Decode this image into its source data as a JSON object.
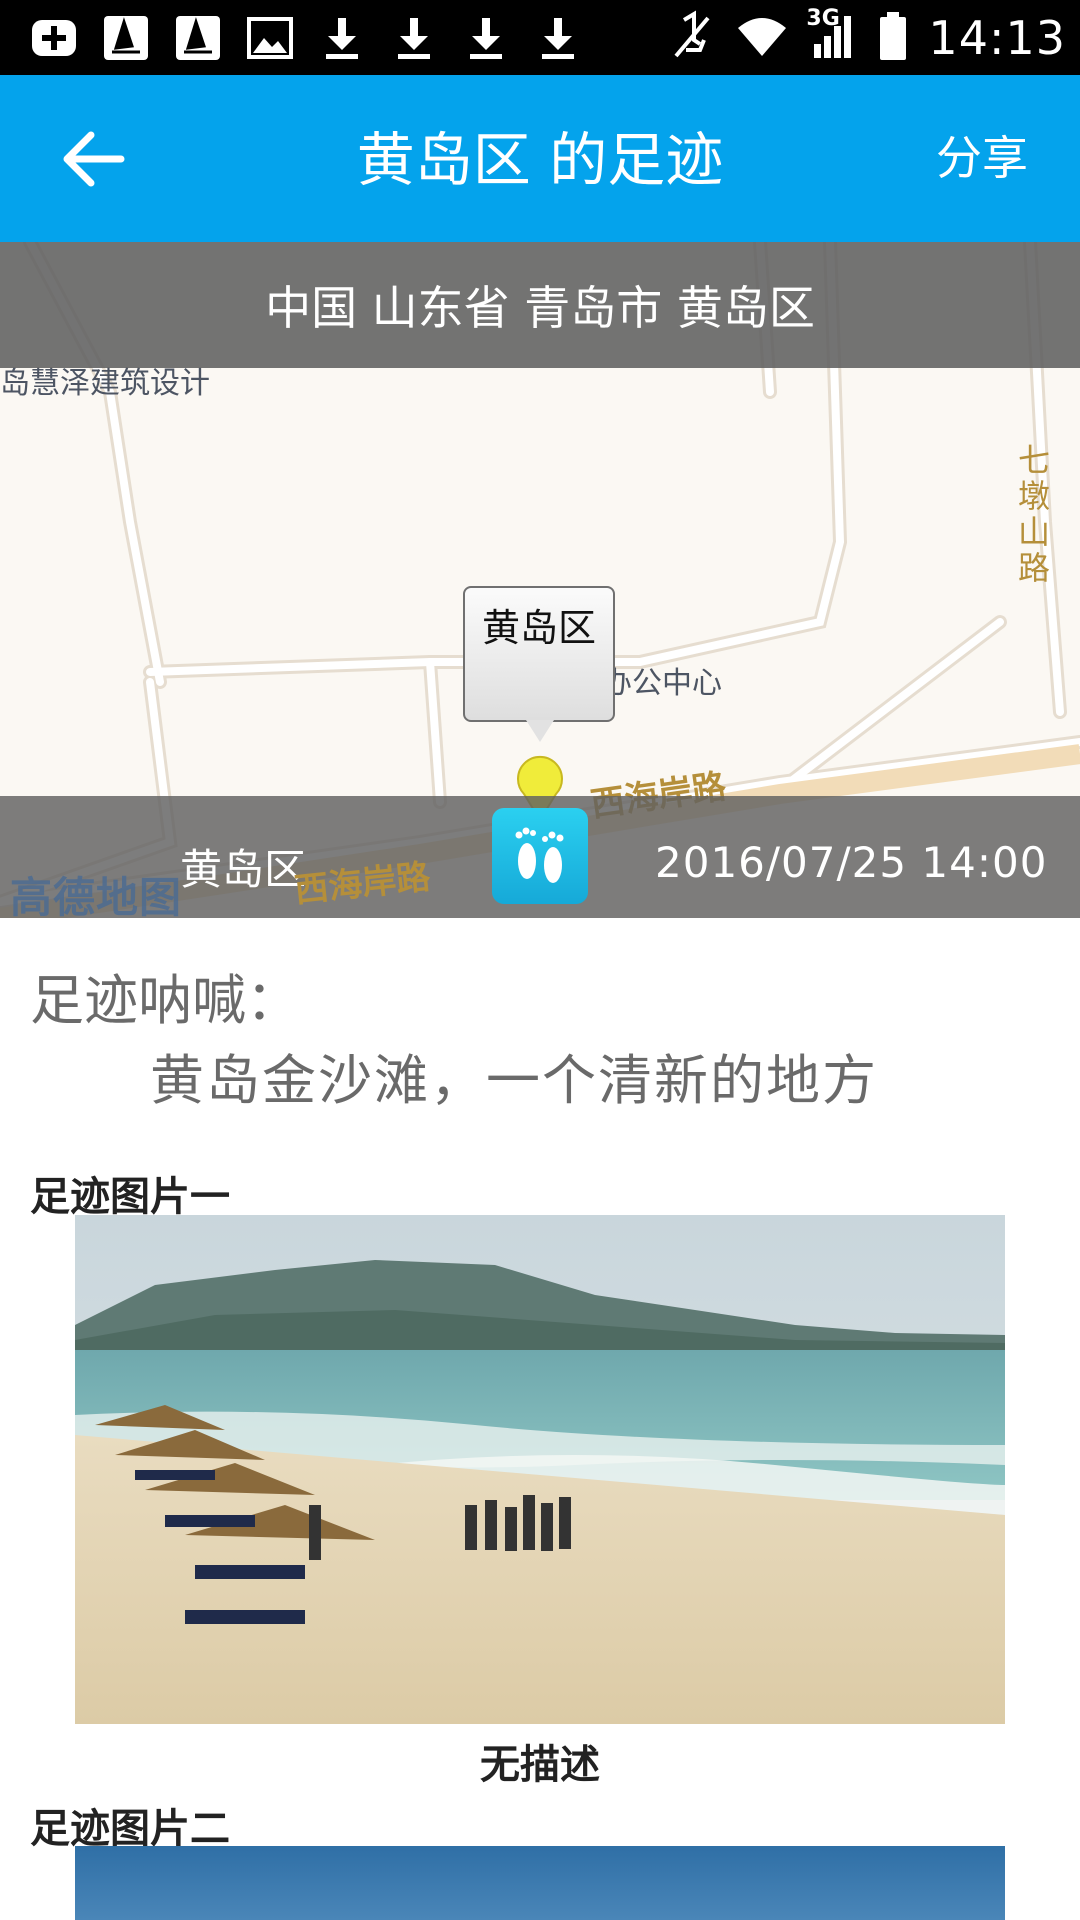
{
  "status_bar": {
    "time": "14:13",
    "network": "3G",
    "left_icons": [
      "add-icon",
      "windsurf-icon",
      "windsurf-icon",
      "image-icon",
      "download-icon",
      "download-icon",
      "download-icon",
      "download-icon"
    ],
    "right_icons": [
      "mute-icon",
      "wifi-icon",
      "signal-icon",
      "battery-icon"
    ]
  },
  "header": {
    "title": "黄岛区 的足迹",
    "share_label": "分享"
  },
  "map": {
    "address": "中国 山东省 青岛市 黄岛区",
    "marker_label": "黄岛区",
    "labels": {
      "top_left": "岛慧泽建筑设计",
      "right_road": "七墩山路",
      "poi": "西部机关办公中心",
      "road_1": "西海岸路",
      "road_2": "西海岸路"
    },
    "provider_logo": "高德地图",
    "footer": {
      "place": "黄岛区",
      "datetime": "2016/07/25 14:00"
    }
  },
  "content": {
    "shout_label": "足迹呐喊：",
    "shout_text": "黄岛金沙滩，一个清新的地方",
    "photos": [
      {
        "label": "足迹图片一",
        "caption": "无描述"
      },
      {
        "label": "足迹图片二"
      }
    ]
  },
  "colors": {
    "header_bg": "#04a3ec",
    "status_bg": "#000000",
    "map_overlay": "#606060",
    "pin": "#f0ec3a"
  }
}
